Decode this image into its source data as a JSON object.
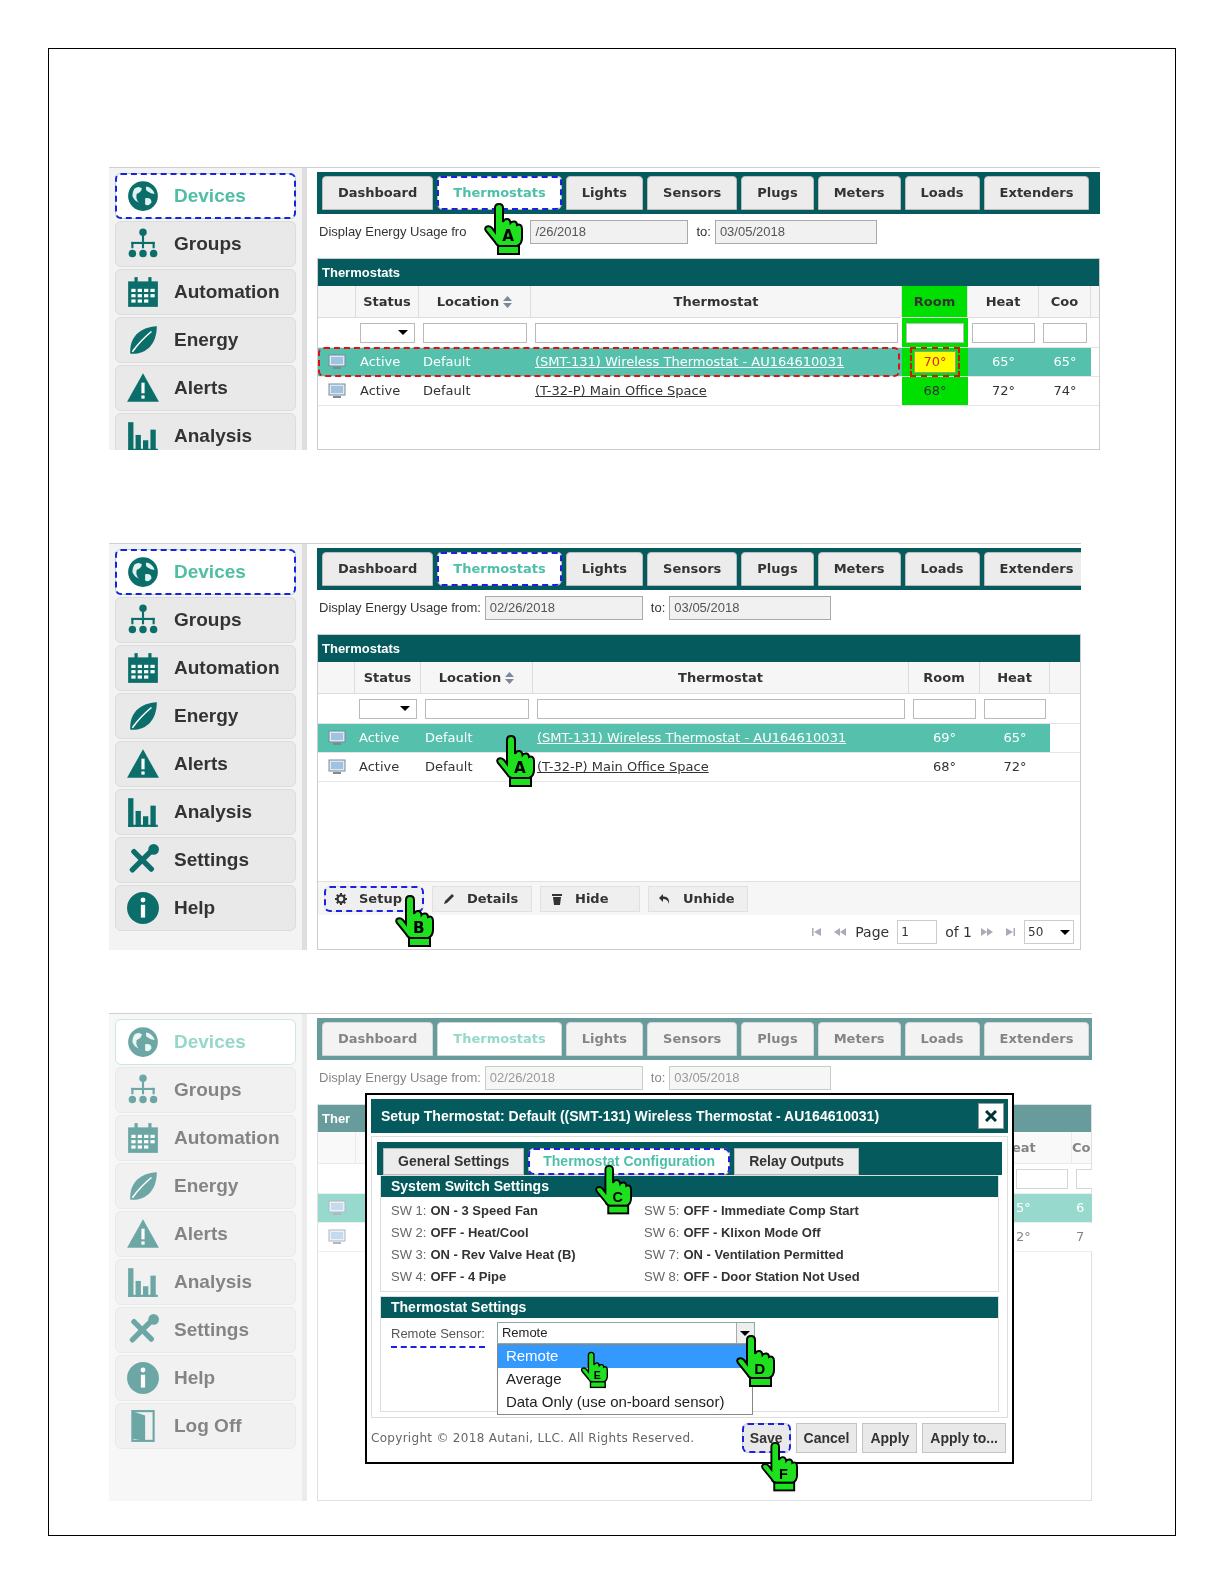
{
  "panels": [
    {
      "faded": false,
      "sidebar": [
        {
          "label": "Devices",
          "selected": true,
          "highlighted": true
        },
        {
          "label": "Groups",
          "selected": false,
          "highlighted": false
        },
        {
          "label": "Automation",
          "selected": false,
          "highlighted": false
        },
        {
          "label": "Energy",
          "selected": false,
          "highlighted": false
        },
        {
          "label": "Alerts",
          "selected": false,
          "highlighted": false
        },
        {
          "label": "Analysis",
          "selected": false,
          "highlighted": false
        }
      ],
      "tabs": [
        {
          "label": "Dashboard",
          "selected": false,
          "highlighted": false
        },
        {
          "label": "Thermostats",
          "selected": true,
          "highlighted": true,
          "callout": "A"
        },
        {
          "label": "Lights",
          "selected": false,
          "highlighted": false
        },
        {
          "label": "Sensors",
          "selected": false,
          "highlighted": false
        },
        {
          "label": "Plugs",
          "selected": false,
          "highlighted": false
        },
        {
          "label": "Meters",
          "selected": false,
          "highlighted": false
        },
        {
          "label": "Loads",
          "selected": false,
          "highlighted": false
        },
        {
          "label": "Extenders",
          "selected": false,
          "highlighted": false
        }
      ],
      "date_label": "Display Energy Usage fro",
      "date_from": "/26/2018",
      "to_label": "to:",
      "date_to": "03/05/2018",
      "grid_title": "Thermostats",
      "columns": [
        {
          "label": "Status",
          "link": false,
          "filter_dropdown": true,
          "sortable": false,
          "emphasized": false
        },
        {
          "label": "Location",
          "link": false,
          "filter_dropdown": false,
          "sortable": true,
          "emphasized": false
        },
        {
          "label": "Thermostat",
          "link": true,
          "filter_dropdown": false,
          "sortable": false,
          "emphasized": false
        },
        {
          "label": "Room",
          "link": false,
          "filter_dropdown": false,
          "sortable": false,
          "emphasized": true
        },
        {
          "label": "Heat",
          "link": false,
          "filter_dropdown": false,
          "sortable": false,
          "emphasized": false
        },
        {
          "label": "Coo",
          "link": false,
          "filter_dropdown": false,
          "sortable": false,
          "emphasized": false
        }
      ],
      "rows": [
        {
          "cells": [
            "Active",
            "Default",
            "(SMT-131) Wireless Thermostat - AU164610031",
            "70°",
            "65°",
            "65°"
          ],
          "selected": true,
          "highlighted": true,
          "room_alert": true
        },
        {
          "cells": [
            "Active",
            "Default",
            "(T-32-P) Main Office Space",
            "68°",
            "72°",
            "74°"
          ],
          "selected": false,
          "highlighted": false,
          "room_alert": false
        }
      ]
    },
    {
      "faded": false,
      "sidebar": [
        {
          "label": "Devices",
          "selected": true,
          "highlighted": true
        },
        {
          "label": "Groups",
          "selected": false,
          "highlighted": false
        },
        {
          "label": "Automation",
          "selected": false,
          "highlighted": false
        },
        {
          "label": "Energy",
          "selected": false,
          "highlighted": false
        },
        {
          "label": "Alerts",
          "selected": false,
          "highlighted": false
        },
        {
          "label": "Analysis",
          "selected": false,
          "highlighted": false
        },
        {
          "label": "Settings",
          "selected": false,
          "highlighted": false
        },
        {
          "label": "Help",
          "selected": false,
          "highlighted": false
        }
      ],
      "tabs": [
        {
          "label": "Dashboard",
          "selected": false,
          "highlighted": false
        },
        {
          "label": "Thermostats",
          "selected": true,
          "highlighted": true
        },
        {
          "label": "Lights",
          "selected": false,
          "highlighted": false
        },
        {
          "label": "Sensors",
          "selected": false,
          "highlighted": false
        },
        {
          "label": "Plugs",
          "selected": false,
          "highlighted": false
        },
        {
          "label": "Meters",
          "selected": false,
          "highlighted": false
        },
        {
          "label": "Loads",
          "selected": false,
          "highlighted": false
        },
        {
          "label": "Extenders",
          "selected": false,
          "highlighted": false
        }
      ],
      "date_label": "Display Energy Usage from:",
      "date_from": "02/26/2018",
      "to_label": "to:",
      "date_to": "03/05/2018",
      "grid_title": "Thermostats",
      "columns": [
        {
          "label": "Status",
          "link": false,
          "filter_dropdown": true,
          "sortable": false,
          "emphasized": false
        },
        {
          "label": "Location",
          "link": false,
          "filter_dropdown": false,
          "sortable": true,
          "emphasized": false
        },
        {
          "label": "Thermostat",
          "link": true,
          "filter_dropdown": false,
          "sortable": false,
          "emphasized": false
        },
        {
          "label": "Room",
          "link": false,
          "filter_dropdown": false,
          "sortable": false,
          "emphasized": false
        },
        {
          "label": "Heat",
          "link": false,
          "filter_dropdown": false,
          "sortable": false,
          "emphasized": false
        }
      ],
      "rows": [
        {
          "cells": [
            "Active",
            "Default",
            "(SMT-131) Wireless Thermostat - AU164610031",
            "69°",
            "65°"
          ],
          "selected": true,
          "callout": "A"
        },
        {
          "cells": [
            "Active",
            "Default",
            "(T-32-P) Main Office Space",
            "68°",
            "72°"
          ],
          "selected": false
        }
      ],
      "toolbar": [
        {
          "label": "Setup",
          "highlighted": true,
          "callout": "B"
        },
        {
          "label": "Details",
          "highlighted": false
        },
        {
          "label": "Hide",
          "highlighted": false
        },
        {
          "label": "Unhide",
          "highlighted": false
        }
      ],
      "pager": {
        "page_label": "Page",
        "page": "1",
        "of": "of 1",
        "page_size": "50"
      }
    },
    {
      "faded": true,
      "sidebar": [
        {
          "label": "Devices",
          "selected": true,
          "highlighted": false
        },
        {
          "label": "Groups",
          "selected": false,
          "highlighted": false
        },
        {
          "label": "Automation",
          "selected": false,
          "highlighted": false
        },
        {
          "label": "Energy",
          "selected": false,
          "highlighted": false
        },
        {
          "label": "Alerts",
          "selected": false,
          "highlighted": false
        },
        {
          "label": "Analysis",
          "selected": false,
          "highlighted": false
        },
        {
          "label": "Settings",
          "selected": false,
          "highlighted": false
        },
        {
          "label": "Help",
          "selected": false,
          "highlighted": false
        },
        {
          "label": "Log Off",
          "selected": false,
          "highlighted": false
        }
      ],
      "tabs": [
        {
          "label": "Dashboard",
          "selected": false,
          "highlighted": false
        },
        {
          "label": "Thermostats",
          "selected": true,
          "highlighted": false
        },
        {
          "label": "Lights",
          "selected": false,
          "highlighted": false
        },
        {
          "label": "Sensors",
          "selected": false,
          "highlighted": false
        },
        {
          "label": "Plugs",
          "selected": false,
          "highlighted": false
        },
        {
          "label": "Meters",
          "selected": false,
          "highlighted": false
        },
        {
          "label": "Loads",
          "selected": false,
          "highlighted": false
        },
        {
          "label": "Extenders",
          "selected": false,
          "highlighted": false
        }
      ],
      "date_label": "Display Energy Usage from:",
      "date_from": "02/26/2018",
      "to_label": "to:",
      "date_to": "03/05/2018",
      "grid_title": "Ther",
      "columns": [
        {
          "label": "eat",
          "link": false,
          "filter_dropdown": false,
          "emphasized": false
        },
        {
          "label": "Co",
          "link": false,
          "filter_dropdown": false,
          "emphasized": false
        }
      ],
      "rows": [
        {
          "cells": [
            "5°",
            "6"
          ],
          "selected": true
        },
        {
          "cells": [
            "2°",
            "7"
          ],
          "selected": false
        }
      ],
      "modal": {
        "title": "Setup Thermostat: Default ((SMT-131) Wireless Thermostat - AU164610031)",
        "tabs": [
          {
            "label": "General Settings",
            "selected": false,
            "highlighted": false
          },
          {
            "label": "Thermostat Configuration",
            "selected": true,
            "highlighted": true,
            "callout": "C"
          },
          {
            "label": "Relay Outputs",
            "selected": false,
            "highlighted": false
          }
        ],
        "switch_section": "System Switch Settings",
        "switches": [
          {
            "label": "SW 1:",
            "value": "ON - 3 Speed Fan"
          },
          {
            "label": "SW 2:",
            "value": "OFF - Heat/Cool"
          },
          {
            "label": "SW 3:",
            "value": "ON - Rev Valve Heat (B)"
          },
          {
            "label": "SW 4:",
            "value": "OFF - 4 Pipe"
          },
          {
            "label": "SW 5:",
            "value": "OFF - Immediate Comp Start"
          },
          {
            "label": "SW 6:",
            "value": "OFF - Klixon Mode Off"
          },
          {
            "label": "SW 7:",
            "value": "ON - Ventilation Permitted"
          },
          {
            "label": "SW 8:",
            "value": "OFF - Door Station Not Used"
          }
        ],
        "settings_section": "Thermostat Settings",
        "remote_sensor": {
          "label": "Remote Sensor:",
          "value": "Remote",
          "highlighted": true,
          "expanded": true,
          "callout": "D",
          "options": [
            {
              "label": "Remote",
              "selected": true,
              "callout": "E"
            },
            {
              "label": "Average",
              "selected": false
            },
            {
              "label": "Data Only (use on-board sensor)",
              "selected": false
            }
          ]
        },
        "copyright": "Copyright © 2018 Autani, LLC. All Rights Reserved.",
        "buttons": [
          {
            "label": "Save",
            "highlighted": true,
            "callout": "F"
          },
          {
            "label": "Cancel",
            "highlighted": false
          },
          {
            "label": "Apply",
            "highlighted": false
          },
          {
            "label": "Apply to...",
            "highlighted": false
          }
        ]
      }
    }
  ]
}
